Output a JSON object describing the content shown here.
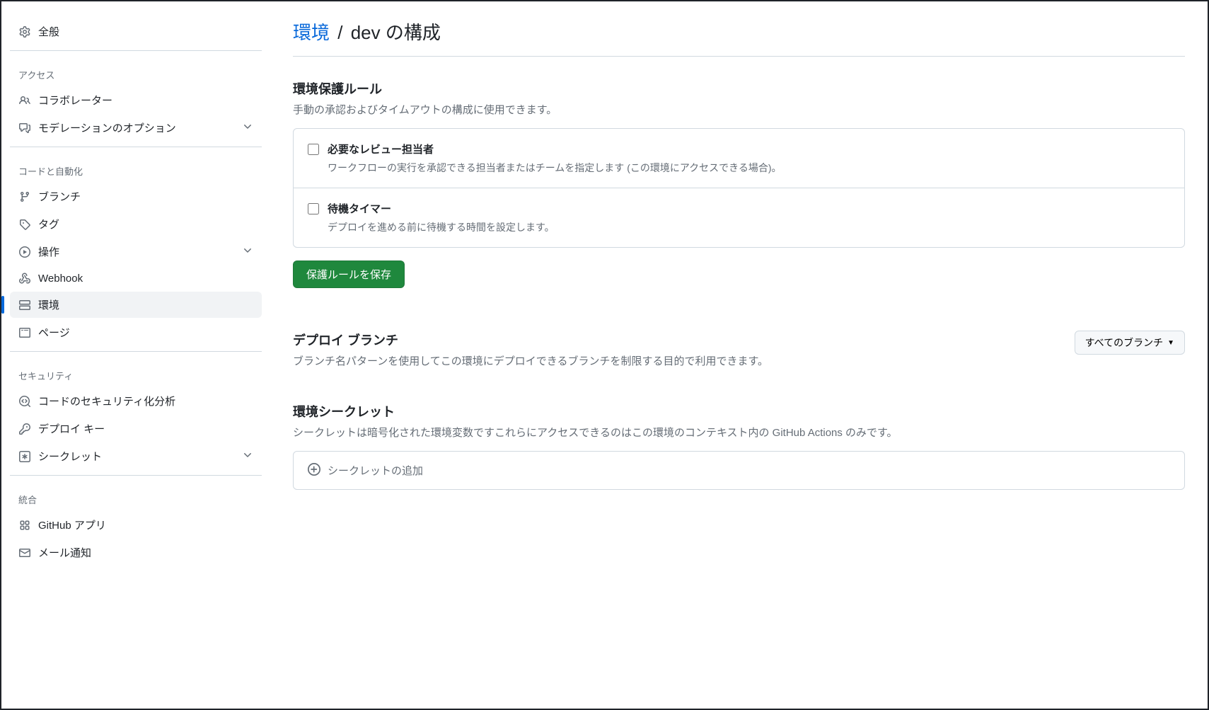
{
  "sidebar": {
    "general": "全般",
    "section_access": "アクセス",
    "collaborators": "コラボレーター",
    "moderation": "モデレーションのオプション",
    "section_code": "コードと自動化",
    "branches": "ブランチ",
    "tags": "タグ",
    "actions": "操作",
    "webhook": "Webhook",
    "environment": "環境",
    "pages": "ページ",
    "section_security": "セキュリティ",
    "code_security": "コードのセキュリティ化分析",
    "deploy_keys": "デプロイ キー",
    "secrets": "シークレット",
    "section_integration": "統合",
    "github_apps": "GitHub アプリ",
    "mail_notification": "メール通知"
  },
  "title": {
    "link": "環境",
    "separator": "/",
    "rest": "dev の構成"
  },
  "protection": {
    "title": "環境保護ルール",
    "description": "手動の承認およびタイムアウトの構成に使用できます。",
    "rule1_title": "必要なレビュー担当者",
    "rule1_description": "ワークフローの実行を承認できる担当者またはチームを指定します (この環境にアクセスできる場合)。",
    "rule2_title": "待機タイマー",
    "rule2_description": "デプロイを進める前に待機する時間を設定します。",
    "save_button": "保護ルールを保存"
  },
  "deploy": {
    "title": "デプロイ ブランチ",
    "description": "ブランチ名パターンを使用してこの環境にデプロイできるブランチを制限する目的で利用できます。",
    "dropdown_label": "すべてのブランチ"
  },
  "secrets": {
    "title": "環境シークレット",
    "description": "シークレットは暗号化された環境変数ですこれらにアクセスできるのはこの環境のコンテキスト内の GitHub Actions のみです。",
    "add_label": "シークレットの追加"
  }
}
